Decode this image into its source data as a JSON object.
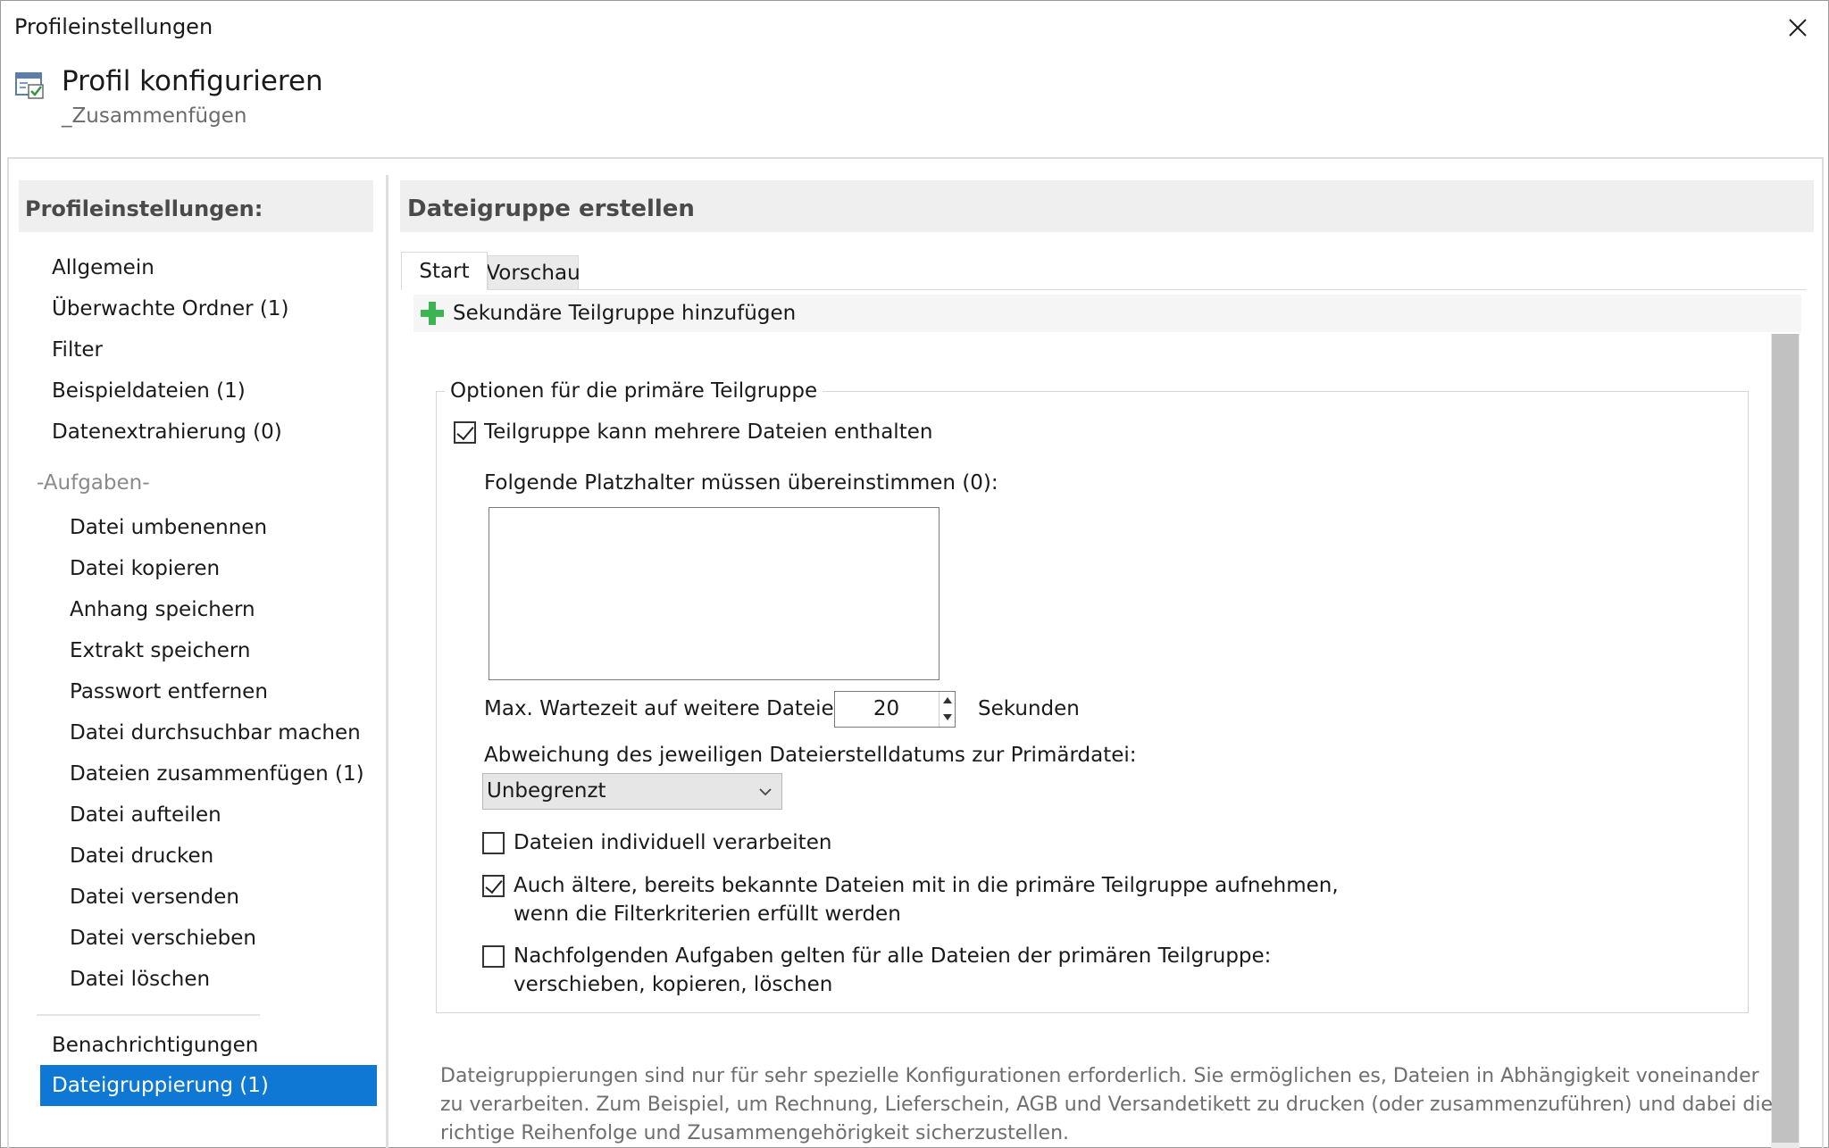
{
  "window": {
    "title": "Profileinstellungen"
  },
  "header": {
    "title": "Profil konfigurieren",
    "subtitle": "_Zusammenfügen"
  },
  "sidebar": {
    "heading": "Profileinstellungen:",
    "items": [
      {
        "label": "Allgemein"
      },
      {
        "label": "Überwachte Ordner (1)"
      },
      {
        "label": "Filter"
      },
      {
        "label": "Beispieldateien (1)"
      },
      {
        "label": "Datenextrahierung (0)"
      }
    ],
    "tasks_group": "-Aufgaben-",
    "tasks": [
      {
        "label": "Datei umbenennen"
      },
      {
        "label": "Datei kopieren"
      },
      {
        "label": "Anhang speichern"
      },
      {
        "label": "Extrakt speichern"
      },
      {
        "label": "Passwort entfernen"
      },
      {
        "label": "Datei durchsuchbar machen"
      },
      {
        "label": "Dateien zusammenfügen (1)"
      },
      {
        "label": "Datei aufteilen"
      },
      {
        "label": "Datei drucken"
      },
      {
        "label": "Datei versenden"
      },
      {
        "label": "Datei verschieben"
      },
      {
        "label": "Datei löschen"
      }
    ],
    "after": [
      {
        "label": "Benachrichtigungen"
      },
      {
        "label": "Dateigruppierung (1)",
        "selected": true
      }
    ]
  },
  "main": {
    "heading": "Dateigruppe erstellen",
    "tabs": [
      {
        "label": "Start",
        "active": true
      },
      {
        "label": "Vorschau"
      }
    ],
    "toolbar": {
      "add_label": "Sekundäre Teilgruppe hinzufügen"
    },
    "group": {
      "legend": "Optionen für die primäre Teilgruppe",
      "multi_files": {
        "label": "Teilgruppe kann mehrere Dateien enthalten",
        "checked": true
      },
      "placeholder_label": "Folgende Platzhalter müssen übereinstimmen (0):",
      "wait_label": "Max. Wartezeit auf weitere Dateien:",
      "wait_value": "20",
      "wait_unit": "Sekunden",
      "deviation_label": "Abweichung des jeweiligen Dateierstelldatums zur Primärdatei:",
      "deviation_value": "Unbegrenzt",
      "individual": {
        "label": "Dateien individuell verarbeiten",
        "checked": false
      },
      "older": {
        "label_line1": "Auch ältere, bereits bekannte Dateien mit in die primäre Teilgruppe aufnehmen,",
        "label_line2": "wenn die Filterkriterien erfüllt werden",
        "checked": true
      },
      "subsequent": {
        "label_line1": "Nachfolgenden Aufgaben gelten für alle Dateien der primären Teilgruppe:",
        "label_line2": "verschieben, kopieren, löschen",
        "checked": false
      }
    },
    "description": "Dateigruppierungen sind nur für sehr spezielle Konfigurationen erforderlich. Sie ermöglichen es, Dateien in Abhängigkeit voneinander zu verarbeiten. Zum Beispiel, um Rechnung, Lieferschein, AGB und Versandetikett zu drucken (oder zusammenzuführen) und dabei die richtige Reihenfolge und Zusammengehörigkeit sicherzustellen."
  },
  "colors": {
    "accent": "#0e78d4",
    "add_icon": "#3cb454",
    "panel_header": "#efefef"
  },
  "icons": {
    "close": "close-icon",
    "app": "profile-settings-icon",
    "add": "plus-icon",
    "dropdown": "chevron-down-icon"
  }
}
